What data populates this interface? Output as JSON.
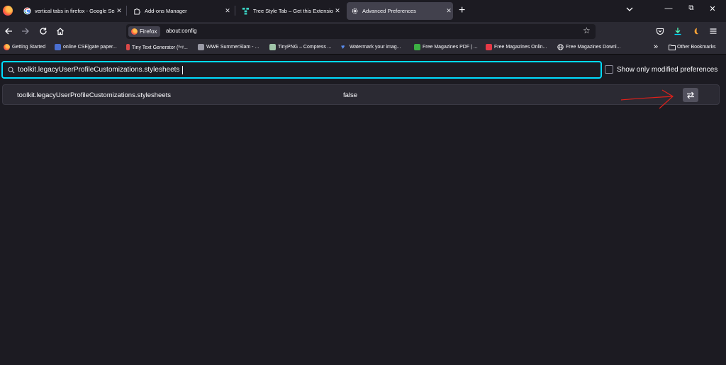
{
  "tabs": [
    {
      "title": "vertical tabs in firefox - Google Search",
      "icon": "google-icon",
      "active": false
    },
    {
      "title": "Add-ons Manager",
      "icon": "puzzle-icon",
      "active": false
    },
    {
      "title": "Tree Style Tab – Get this Extension for Firefox",
      "icon": "tree-style-tab-icon",
      "active": false
    },
    {
      "title": "Advanced Preferences",
      "icon": "gear-icon",
      "active": true
    }
  ],
  "navbar": {
    "identity_label": "Firefox",
    "url": "about:config"
  },
  "bookmarks": [
    {
      "label": "Getting Started",
      "icon": "firefox-icon",
      "color": "#ff7139"
    },
    {
      "label": "online CSE|gate paper...",
      "icon": "page-icon",
      "color": "#4a6fd1"
    },
    {
      "label": "Tiny Text Generator (ᵗⁱⁿʸ...",
      "icon": "page-icon",
      "color": "#d94848"
    },
    {
      "label": "WWE SummerSlam - ...",
      "icon": "page-icon",
      "color": "#9a9aa6"
    },
    {
      "label": "TinyPNG – Compress ...",
      "icon": "page-icon",
      "color": "#9fc4a8"
    },
    {
      "label": "Watermark your imag...",
      "icon": "heart-icon",
      "color": "#5a8dee"
    },
    {
      "label": "Free Magazines PDF | ...",
      "icon": "download-icon",
      "color": "#3cb043"
    },
    {
      "label": "Free Magazines Onlin...",
      "icon": "page-icon",
      "color": "#e63946"
    },
    {
      "label": "Free Magazines Downl...",
      "icon": "globe-icon",
      "color": "#fbfbfe"
    }
  ],
  "other_bookmarks": "Other Bookmarks",
  "search": {
    "value": "toolkit.legacyUserProfileCustomizations.stylesheets"
  },
  "show_modified_label": "Show only modified preferences",
  "preference": {
    "name": "toolkit.legacyUserProfileCustomizations.stylesheets",
    "value": "false"
  },
  "colors": {
    "focus": "#00ddff",
    "annotation": "#e0201a",
    "background": "#1c1b22"
  }
}
